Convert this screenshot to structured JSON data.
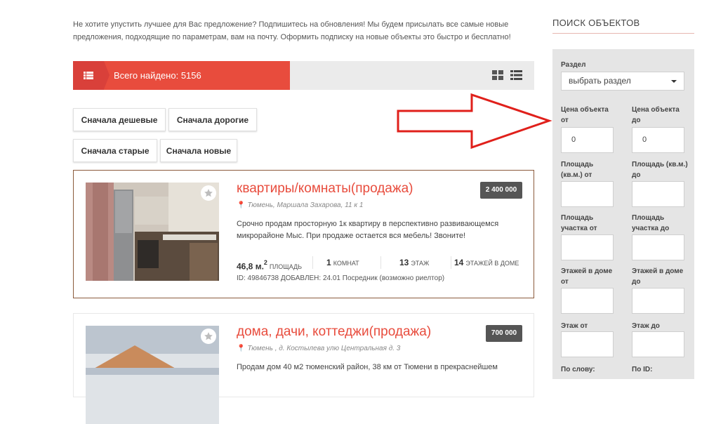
{
  "notice": "Не хотите упустить лучшее для Вас предложение? Подпишитесь на обновления! Мы будем присылать все самые новые предложения, подходящие по параметрам, вам на почту. Оформить подписку на новые объекты это быстро и бесплатно!",
  "results": {
    "label": "Всего найдено: 5156"
  },
  "sort": {
    "cheap_first": "Сначала дешевые",
    "expensive_first": "Сначала дорогие",
    "old_first": "Сначала старые",
    "new_first": "Сначала новые"
  },
  "listings": [
    {
      "title": "квартиры/комнаты(продажа)",
      "address": "Тюмень, Маршала Захарова, 11 к 1",
      "price": "2 400 000",
      "description": "Срочно продам просторную 1к квартиру в перспективно развивающемся микрорайоне Мыс. При продаже остается вся мебель! Звоните!",
      "area_value": "46,8 м.",
      "area_sup": "2",
      "area_label": "площадь",
      "rooms_value": "1",
      "rooms_label": "комнат",
      "floor_value": "13",
      "floor_label": "этаж",
      "floors_value": "14",
      "floors_label": "этажей в доме",
      "meta": "ID: 49846738 ДОБАВЛЕН: 24.01 Посредник (возможно риелтор)"
    },
    {
      "title": "дома, дачи, коттеджи(продажа)",
      "address": "Тюмень , д. Костылева улю Центральная д. 3",
      "price": "700 000",
      "description": "Продам дом 40 м2 тюменский район, 38 км от Тюмени в прекраснейшем"
    }
  ],
  "sidebar": {
    "title": "ПОИСК ОБЪЕКТОВ",
    "section_label": "Раздел",
    "section_value": "выбрать раздел",
    "price_from_label": "Цена объекта от",
    "price_from_value": "0",
    "price_to_label": "Цена объекта до",
    "price_to_value": "0",
    "area_from_label": "Площадь (кв.м.) от",
    "area_to_label": "Площадь (кв.м.) до",
    "lot_from_label": "Площадь участка от",
    "lot_to_label": "Площадь участка до",
    "floors_from_label": "Этажей в доме от",
    "floors_to_label": "Этажей в доме до",
    "floor_from_label": "Этаж от",
    "floor_to_label": "Этаж до",
    "bottom_left_label": "По слову:",
    "bottom_right_label": "По ID:"
  },
  "colors": {
    "accent": "#e84c3d",
    "accent_dark": "#d9403a",
    "highlight_border": "#8b5a3c",
    "arrow": "#e0201b"
  },
  "icons": [
    "list-icon",
    "grid-view-icon",
    "list-view-icon",
    "star-icon",
    "map-pin-icon",
    "arrow-annotation"
  ]
}
